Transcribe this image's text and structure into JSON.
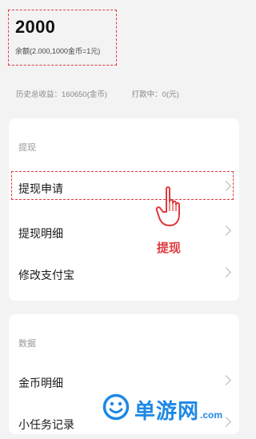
{
  "balance": {
    "value": "2000",
    "note": "余额(2.000,1000金币=1元)"
  },
  "stats": {
    "total_earnings": "历史总收益：160650(金币)",
    "pending": "打款中：0(元)"
  },
  "withdraw_section": {
    "title": "提现",
    "items": [
      {
        "label": "提现申请"
      },
      {
        "label": "提现明细"
      },
      {
        "label": "修改支付宝"
      }
    ]
  },
  "data_section": {
    "title": "数据",
    "items": [
      {
        "label": "金币明细"
      },
      {
        "label": "小任务记录"
      }
    ]
  },
  "annotation": {
    "caption": "提现"
  },
  "watermark": {
    "main": "单游网",
    "suffix": ".com"
  },
  "colors": {
    "annotation_red": "#e0393e",
    "watermark_blue": "#1e88e5"
  },
  "icons": {
    "hand": "pointing-hand-icon",
    "chevron": "chevron-right-icon",
    "logo": "smiley-logo-icon"
  }
}
